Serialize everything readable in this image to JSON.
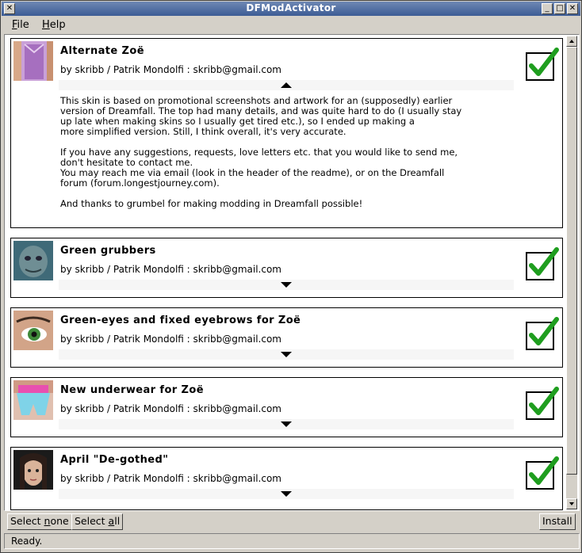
{
  "window": {
    "title": "DFModActivator",
    "close_glyph": "✕",
    "minimize_glyph": "_",
    "maximize_glyph": "□",
    "close2_glyph": "✕"
  },
  "menu": {
    "items": [
      {
        "mnemonic": "F",
        "rest": "ile"
      },
      {
        "mnemonic": "H",
        "rest": "elp"
      }
    ]
  },
  "mods": [
    {
      "title": "Alternate Zoë",
      "author": "by skribb / Patrik Mondolfi : skribb@gmail.com",
      "expanded": true,
      "checked": true,
      "description": "This skin is based on promotional screenshots and artwork for an (supposedly) earlier\nversion of Dreamfall. The top had many details, and was quite hard to do (I usually stay\nup late when making skins so I usually get tired etc.), so I ended up making a\nmore simplified version. Still, I think overall, it's very accurate.\n\nIf you have any suggestions, requests, love letters etc. that you would like to send me,\ndon't hesitate to contact me.\nYou may reach me via email (look in the header of the readme), or on the Dreamfall\nforum (forum.longestjourney.com).\n\nAnd thanks to grumbel for making modding in Dreamfall possible!"
    },
    {
      "title": "Green grubbers",
      "author": "by skribb / Patrik Mondolfi : skribb@gmail.com",
      "expanded": false,
      "checked": true
    },
    {
      "title": "Green-eyes and fixed eyebrows for Zoë",
      "author": "by skribb / Patrik Mondolfi : skribb@gmail.com",
      "expanded": false,
      "checked": true
    },
    {
      "title": "New underwear for Zoë",
      "author": "by skribb / Patrik Mondolfi : skribb@gmail.com",
      "expanded": false,
      "checked": true
    },
    {
      "title": "April \"De-gothed\"",
      "author": "by skribb / Patrik Mondolfi : skribb@gmail.com",
      "expanded": false,
      "checked": true
    }
  ],
  "buttons": {
    "select_none": {
      "before": "Select ",
      "mnemonic": "n",
      "after": "one"
    },
    "select_all": {
      "before": "Select ",
      "mnemonic": "a",
      "after": "ll"
    },
    "install": "Install"
  },
  "status": "Ready.",
  "colors": {
    "titlebar": "#3d5c95",
    "check_green": "#1f9e1f",
    "window_bg": "#d4d0c8"
  }
}
